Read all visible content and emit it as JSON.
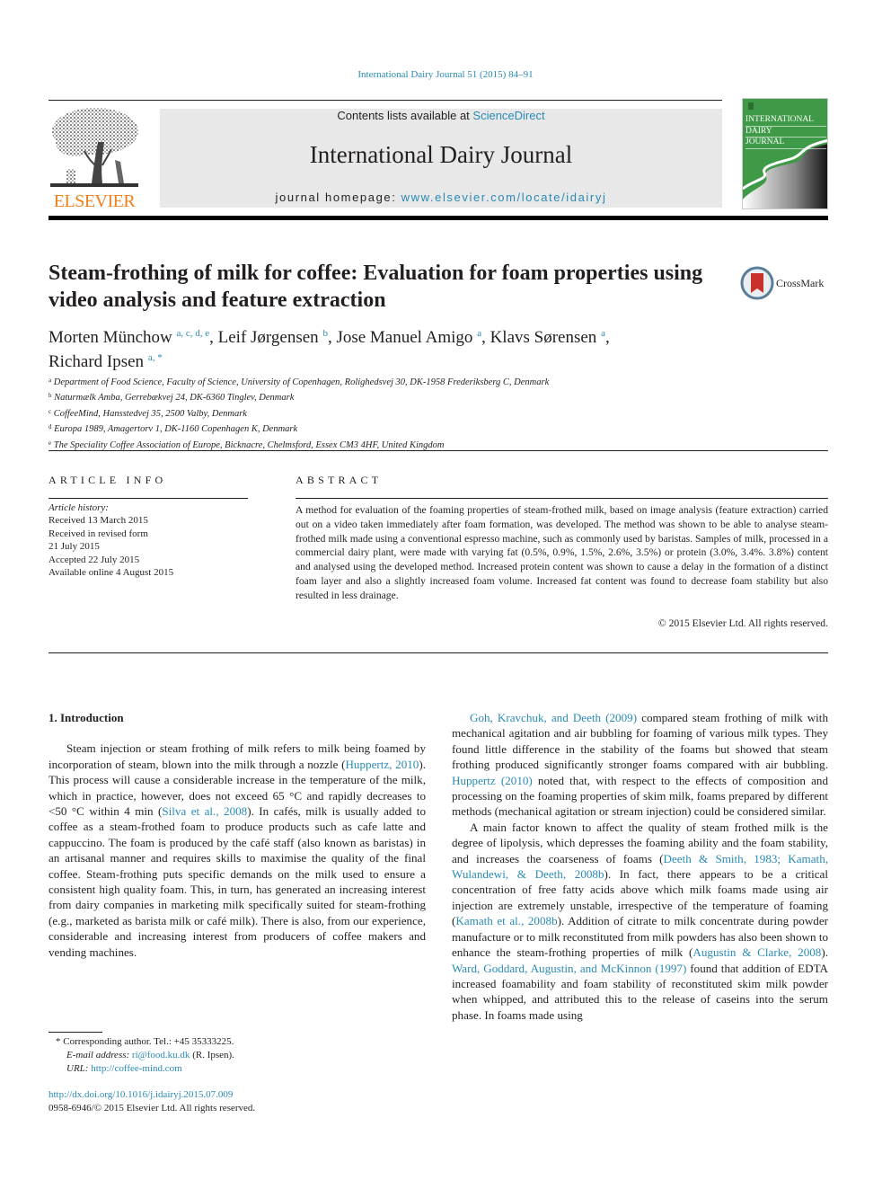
{
  "running_head": "International Dairy Journal 51 (2015) 84–91",
  "masthead": {
    "publisher_wordmark": "ELSEVIER",
    "contents_prefix": "Contents lists available at ",
    "contents_link": "ScienceDirect",
    "journal_name": "International Dairy Journal",
    "homepage_prefix": "journal homepage: ",
    "homepage_link": "www.elsevier.com/locate/idairyj",
    "cover_title_lines": [
      "INTERNATIONAL",
      "DAIRY",
      "JOURNAL"
    ],
    "colors": {
      "elsevier_orange": "#f07f1d",
      "link_blue": "#2a8ab5",
      "cover_green": "#3f9a47",
      "masthead_gray": "#e8e8e8"
    }
  },
  "article": {
    "title": "Steam-frothing of milk for coffee: Evaluation for foam properties using video analysis and feature extraction",
    "crossmark_label": "CrossMark",
    "authors": [
      {
        "name": "Morten Münchow",
        "sup": "a, c, d, e",
        "sep": ", "
      },
      {
        "name": "Leif Jørgensen",
        "sup": "b",
        "sep": ", "
      },
      {
        "name": "Jose Manuel Amigo",
        "sup": "a",
        "sep": ", "
      },
      {
        "name": "Klavs Sørensen",
        "sup": "a",
        "sep": ","
      },
      {
        "name": "Richard Ipsen",
        "sup": "a, *",
        "sep": ""
      }
    ],
    "affiliations": [
      {
        "key": "a",
        "text": "Department of Food Science, Faculty of Science, University of Copenhagen, Rolighedsvej 30, DK-1958 Frederiksberg C, Denmark"
      },
      {
        "key": "b",
        "text": "Naturmælk Amba, Gerrebækvej 24, DK-6360 Tinglev, Denmark"
      },
      {
        "key": "c",
        "text": "CoffeeMind, Hansstedvej 35, 2500 Valby, Denmark"
      },
      {
        "key": "d",
        "text": "Europa 1989, Amagertorv 1, DK-1160 Copenhagen K, Denmark"
      },
      {
        "key": "e",
        "text": "The Speciality Coffee Association of Europe, Bicknacre, Chelmsford, Essex CM3 4HF, United Kingdom"
      }
    ]
  },
  "article_info": {
    "label": "ARTICLE INFO",
    "history_title": "Article history:",
    "history": [
      "Received 13 March 2015",
      "Received in revised form",
      "21 July 2015",
      "Accepted 22 July 2015",
      "Available online 4 August 2015"
    ]
  },
  "abstract": {
    "label": "ABSTRACT",
    "text": "A method for evaluation of the foaming properties of steam-frothed milk, based on image analysis (feature extraction) carried out on a video taken immediately after foam formation, was developed. The method was shown to be able to analyse steam-frothed milk made using a conventional espresso ma­chine, such as commonly used by baristas. Samples of milk, processed in a commercial dairy plant, were made with varying fat (0.5%, 0.9%, 1.5%, 2.6%, 3.5%) or protein (3.0%, 3.4%. 3.8%) content and analysed using the developed method. Increased protein content was shown to cause a delay in the formation of a distinct foam layer and also a slightly increased foam volume. Increased fat content was found to decrease foam stability but also resulted in less drainage.",
    "copyright": "© 2015 Elsevier Ltd. All rights reserved."
  },
  "body": {
    "section_heading": "1.  Introduction",
    "left_paragraph": [
      {
        "t": "Steam injection or steam frothing of milk refers to milk being foamed by incorporation of steam, blown into the milk through a nozzle ("
      },
      {
        "link": "Huppertz, 2010"
      },
      {
        "t": "). This process will cause a considerable increase in the temperature of the milk, which in practice, however, does not exceed 65 °C and rapidly decreases to <50 °C within 4 min ("
      },
      {
        "link": "Silva et al., 2008"
      },
      {
        "t": "). In cafés, milk is usually added to coffee as a steam-frothed foam to produce products such as cafe latte and cappuccino. The foam is produced by the café staff (also known as baristas) in an artisanal manner and requires skills to maximise the quality of the final coffee. Steam-frothing puts specific demands on the milk used to ensure a consistent high quality foam. This, in turn, has generated an increasing interest from dairy companies in marketing milk specifically suited for steam-frothing (e.g., mar­keted as barista milk or café milk). There is also, from our experi­ence, considerable and increasing interest from producers of coffee makers and vending machines."
      }
    ],
    "right_paragraph_1": [
      {
        "link": "Goh, Kravchuk, and Deeth (2009)"
      },
      {
        "t": " compared steam frothing of milk with mechanical agitation and air bubbling for foaming of various milk types. They found little difference in the stability of the foams but showed that steam frothing produced significantly stronger foams compared with air bubbling. "
      },
      {
        "link": "Huppertz (2010)"
      },
      {
        "t": " noted that, with respect to the effects of composition and processing on the foaming properties of skim milk, foams prepared by different methods (mechanical agitation or stream injection) could be considered similar."
      }
    ],
    "right_paragraph_2": [
      {
        "t": "A main factor known to affect the quality of steam frothed milk is the degree of lipolysis, which depresses the foaming ability and the foam stability, and increases the coarseness of foams ("
      },
      {
        "link": "Deeth & Smith, 1983; Kamath, Wulandewi, & Deeth, 2008b"
      },
      {
        "t": "). In fact, there appears to be a critical concentration of free fatty acids above which milk foams made using air injection are extremely unstable, irre­spective of the temperature of foaming ("
      },
      {
        "link": "Kamath et al., 2008b"
      },
      {
        "t": "). Addition of citrate to milk concentrate during powder manufacture or to milk reconstituted from milk powders has also been shown to enhance the steam-frothing properties of milk ("
      },
      {
        "link": "Augustin & Clarke, 2008"
      },
      {
        "t": "). "
      },
      {
        "link": "Ward, Goddard, Augustin, and McKinnon (1997)"
      },
      {
        "t": " found that addition of EDTA increased foamability and foam stability of reconstituted skim milk powder when whipped, and attributed this to the release of caseins into the serum phase. In foams made using"
      }
    ]
  },
  "footnotes": {
    "corresponding": "*  Corresponding author. Tel.: +45 35333225.",
    "email_label": "E-mail address:",
    "email": "ri@food.ku.dk",
    "email_suffix": " (R. Ipsen).",
    "url_label": "URL:",
    "url": "http://coffee-mind.com",
    "doi": "http://dx.doi.org/10.1016/j.idairyj.2015.07.009",
    "issn_copyright": "0958-6946/© 2015 Elsevier Ltd. All rights reserved."
  }
}
